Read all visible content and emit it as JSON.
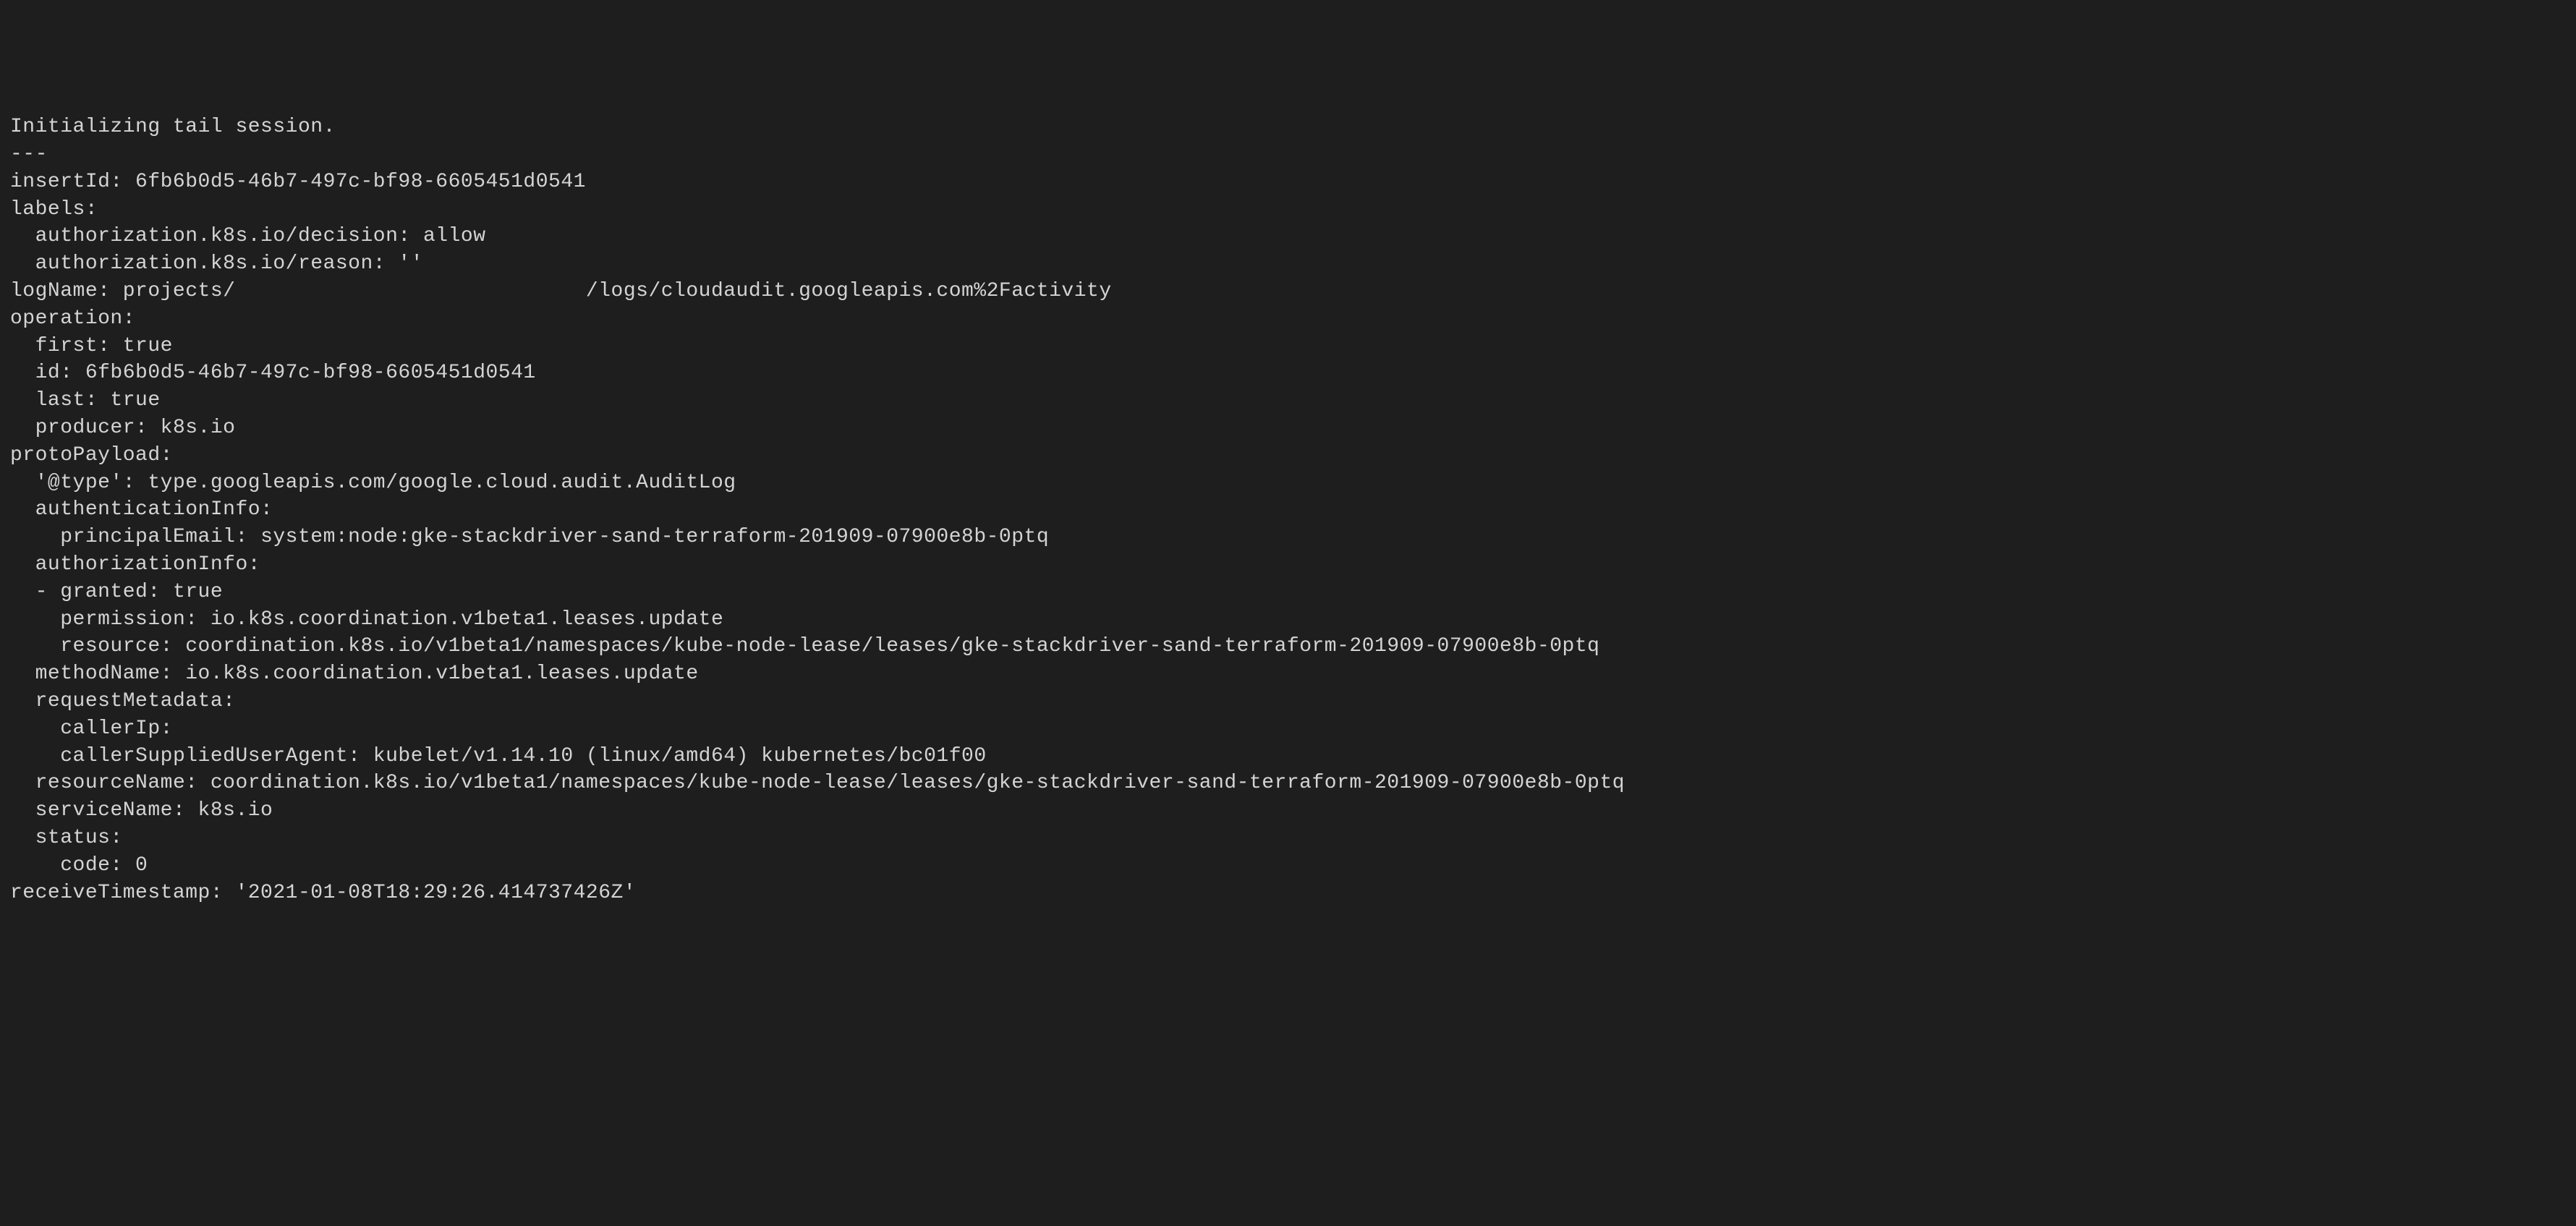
{
  "terminal": {
    "lines": [
      "Initializing tail session.",
      "---",
      "insertId: 6fb6b0d5-46b7-497c-bf98-6605451d0541",
      "labels:",
      "  authorization.k8s.io/decision: allow",
      "  authorization.k8s.io/reason: ''",
      "logName: projects/                            /logs/cloudaudit.googleapis.com%2Factivity",
      "operation:",
      "  first: true",
      "  id: 6fb6b0d5-46b7-497c-bf98-6605451d0541",
      "  last: true",
      "  producer: k8s.io",
      "protoPayload:",
      "  '@type': type.googleapis.com/google.cloud.audit.AuditLog",
      "  authenticationInfo:",
      "    principalEmail: system:node:gke-stackdriver-sand-terraform-201909-07900e8b-0ptq",
      "  authorizationInfo:",
      "  - granted: true",
      "    permission: io.k8s.coordination.v1beta1.leases.update",
      "    resource: coordination.k8s.io/v1beta1/namespaces/kube-node-lease/leases/gke-stackdriver-sand-terraform-201909-07900e8b-0ptq",
      "  methodName: io.k8s.coordination.v1beta1.leases.update",
      "  requestMetadata:",
      "    callerIp:",
      "    callerSuppliedUserAgent: kubelet/v1.14.10 (linux/amd64) kubernetes/bc01f00",
      "  resourceName: coordination.k8s.io/v1beta1/namespaces/kube-node-lease/leases/gke-stackdriver-sand-terraform-201909-07900e8b-0ptq",
      "  serviceName: k8s.io",
      "  status:",
      "    code: 0",
      "receiveTimestamp: '2021-01-08T18:29:26.414737426Z'"
    ]
  }
}
